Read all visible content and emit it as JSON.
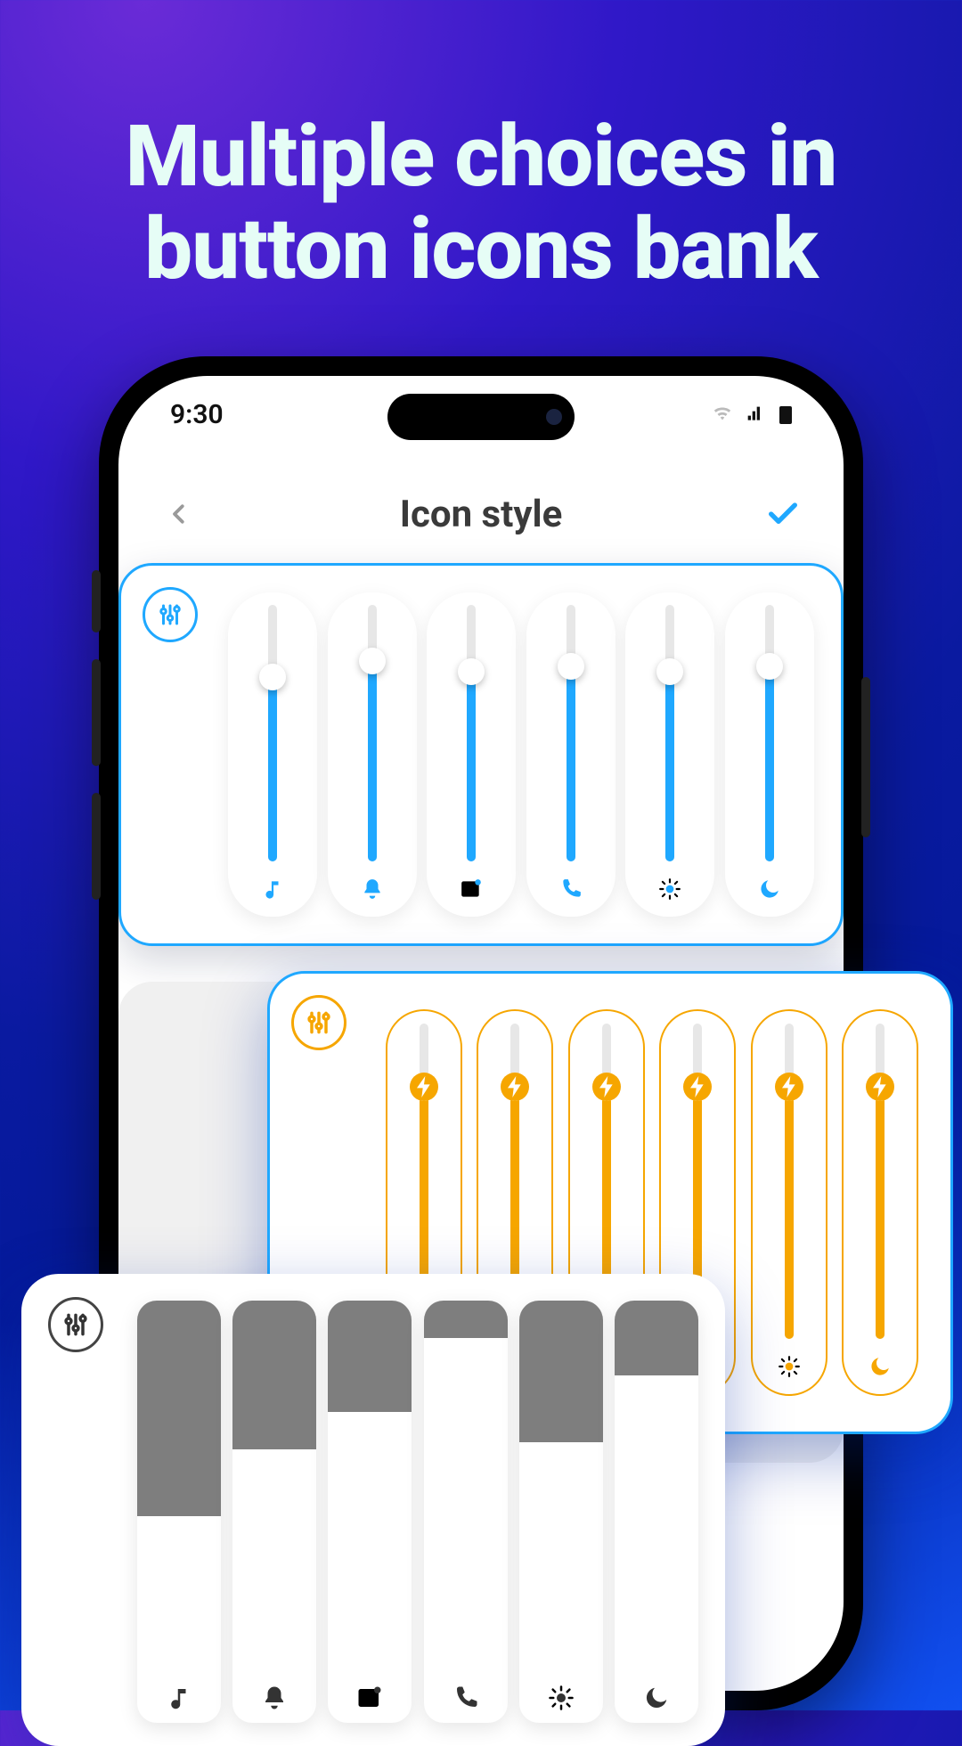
{
  "headline": "Multiple choices in button icons bank",
  "status": {
    "time": "9:30"
  },
  "nav": {
    "title": "Icon style"
  },
  "colors": {
    "blue": "#1fa8ff",
    "orange": "#f6a600",
    "gray": "#7e7e7e"
  },
  "slider_icons": [
    "music",
    "bell",
    "card",
    "phone",
    "sun",
    "moon"
  ],
  "card_blue": {
    "fills_pct": [
      72,
      78,
      74,
      76,
      74,
      76
    ]
  },
  "card_orange": {
    "fills_pct": [
      80,
      80,
      80,
      80,
      80,
      80
    ]
  },
  "card_gray": {
    "fills_pct": [
      58,
      40,
      30,
      10,
      38,
      20
    ]
  }
}
